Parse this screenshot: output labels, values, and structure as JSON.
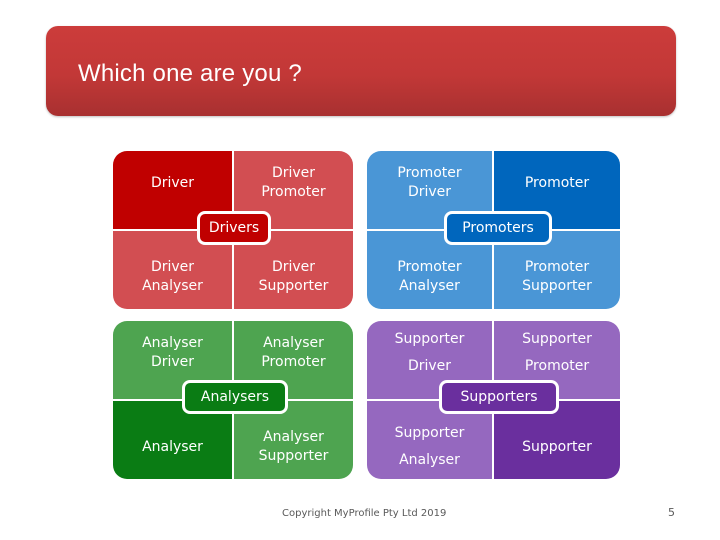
{
  "title": "Which one are you ?",
  "colors": {
    "drivers": {
      "dark": "#c00000",
      "light": "#d24e52"
    },
    "promoters": {
      "dark": "#0066bd",
      "light": "#4a96d6"
    },
    "analysers": {
      "dark": "#0a7c14",
      "light": "#4ea450"
    },
    "supporters": {
      "dark": "#6a2f9e",
      "light": "#9568bf"
    }
  },
  "groups": {
    "drivers": {
      "label": "Drivers",
      "top_left": "Driver",
      "top_right": "Driver\nPromoter",
      "bottom_left": "Driver\nAnalyser",
      "bottom_right": "Driver\nSupporter"
    },
    "promoters": {
      "label": "Promoters",
      "top_left": "Promoter\nDriver",
      "top_right": "Promoter",
      "bottom_left": "Promoter\nAnalyser",
      "bottom_right": "Promoter\nSupporter"
    },
    "analysers": {
      "label": "Analysers",
      "top_left": "Analyser\nDriver",
      "top_right": "Analyser\nPromoter",
      "bottom_left": "Analyser",
      "bottom_right": "Analyser\nSupporter"
    },
    "supporters": {
      "label": "Supporters",
      "top_left": "Supporter\nDriver",
      "top_right": "Supporter\nPromoter",
      "bottom_left": "Supporter\nAnalyser",
      "bottom_right": "Supporter"
    }
  },
  "footer": {
    "copyright": "Copyright MyProfile Pty Ltd 2019",
    "page_number": "5"
  }
}
